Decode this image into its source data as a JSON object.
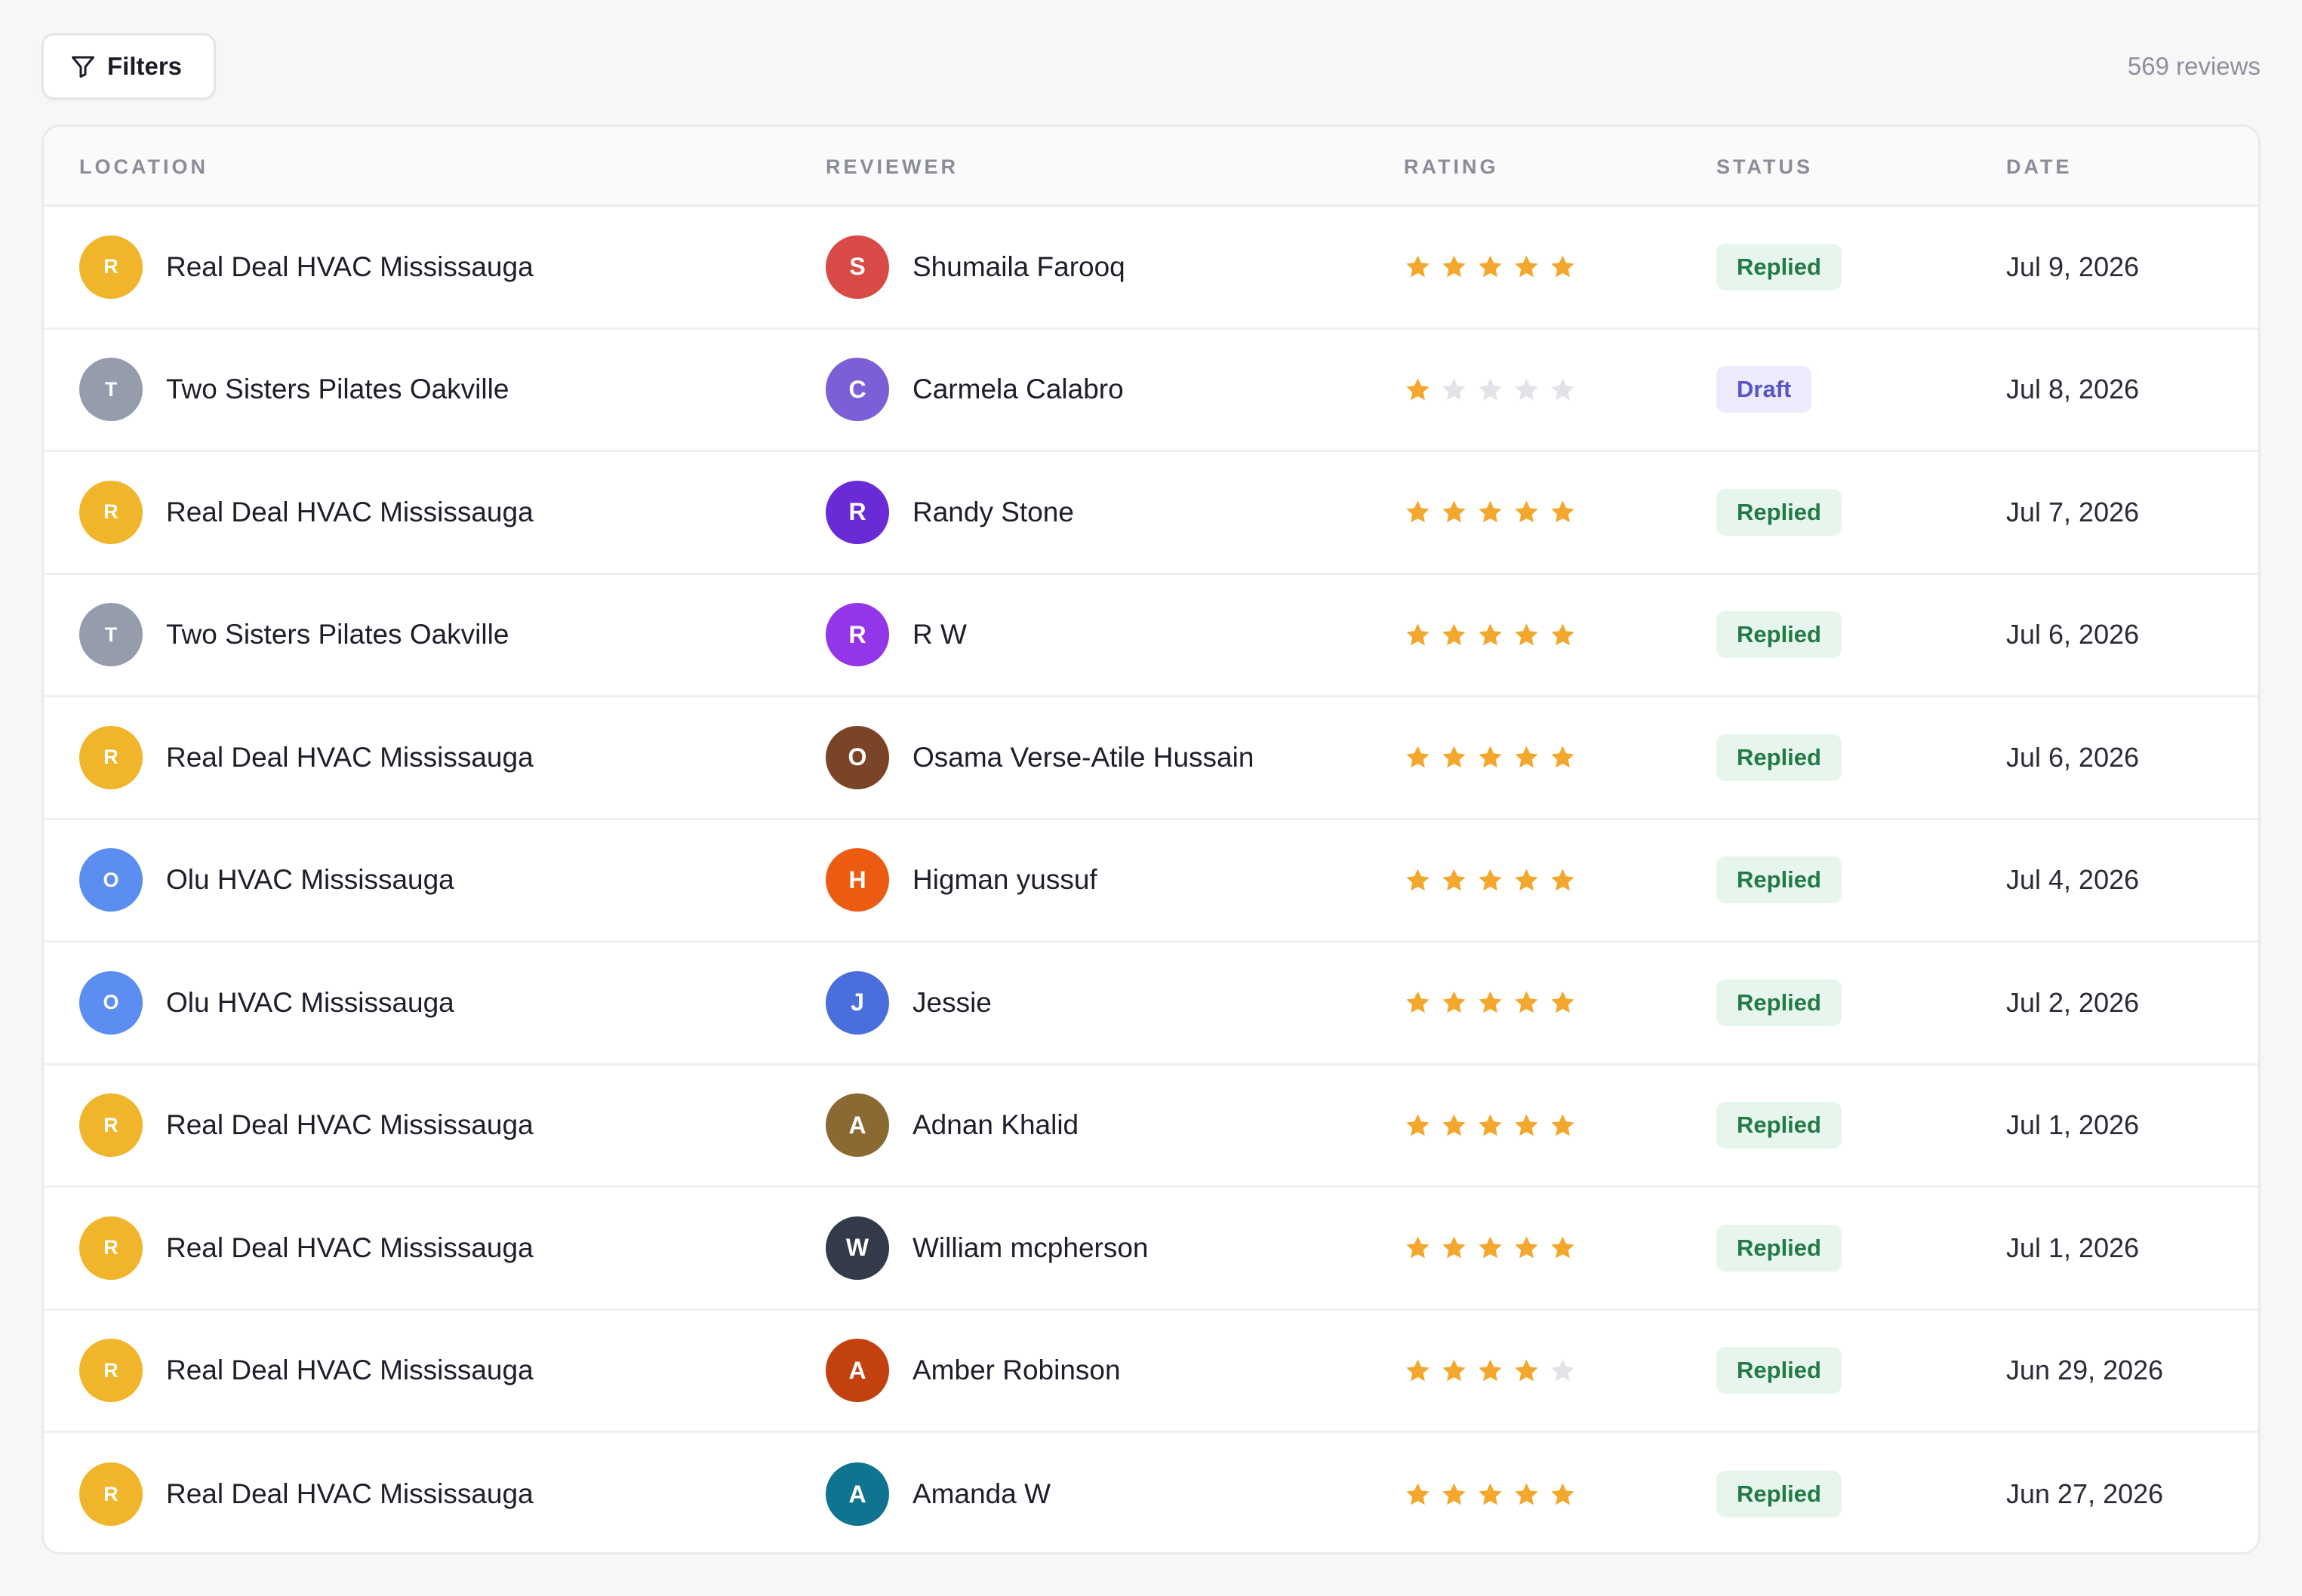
{
  "toolbar": {
    "filters_label": "Filters",
    "review_count": "569 reviews"
  },
  "table": {
    "columns": [
      "LOCATION",
      "REVIEWER",
      "RATING",
      "STATUS",
      "DATE"
    ],
    "rows": [
      {
        "location": "Real Deal HVAC Mississauga",
        "location_initial": "R",
        "location_color": "#f0b52a",
        "reviewer": "Shumaila Farooq",
        "reviewer_initial": "S",
        "reviewer_color": "#d94a47",
        "rating": 5,
        "status": "Replied",
        "date": "Jul 9, 2026"
      },
      {
        "location": "Two Sisters Pilates Oakville",
        "location_initial": "T",
        "location_color": "#959cab",
        "reviewer": "Carmela Calabro",
        "reviewer_initial": "C",
        "reviewer_color": "#7c5fd6",
        "rating": 1,
        "status": "Draft",
        "date": "Jul 8, 2026"
      },
      {
        "location": "Real Deal HVAC Mississauga",
        "location_initial": "R",
        "location_color": "#f0b52a",
        "reviewer": "Randy Stone",
        "reviewer_initial": "R",
        "reviewer_color": "#6a2ad6",
        "rating": 5,
        "status": "Replied",
        "date": "Jul 7, 2026"
      },
      {
        "location": "Two Sisters Pilates Oakville",
        "location_initial": "T",
        "location_color": "#959cab",
        "reviewer": "R W",
        "reviewer_initial": "R",
        "reviewer_color": "#9335e8",
        "rating": 5,
        "status": "Replied",
        "date": "Jul 6, 2026"
      },
      {
        "location": "Real Deal HVAC Mississauga",
        "location_initial": "R",
        "location_color": "#f0b52a",
        "reviewer": "Osama Verse-Atile Hussain",
        "reviewer_initial": "O",
        "reviewer_color": "#7a4426",
        "rating": 5,
        "status": "Replied",
        "date": "Jul 6, 2026"
      },
      {
        "location": "Olu HVAC Mississauga",
        "location_initial": "O",
        "location_color": "#5b8ef0",
        "reviewer": "Higman yussuf",
        "reviewer_initial": "H",
        "reviewer_color": "#ec5b12",
        "rating": 5,
        "status": "Replied",
        "date": "Jul 4, 2026"
      },
      {
        "location": "Olu HVAC Mississauga",
        "location_initial": "O",
        "location_color": "#5b8ef0",
        "reviewer": "Jessie",
        "reviewer_initial": "J",
        "reviewer_color": "#4a6fdc",
        "rating": 5,
        "status": "Replied",
        "date": "Jul 2, 2026"
      },
      {
        "location": "Real Deal HVAC Mississauga",
        "location_initial": "R",
        "location_color": "#f0b52a",
        "reviewer": "Adnan Khalid",
        "reviewer_initial": "A",
        "reviewer_color": "#8a6a32",
        "rating": 5,
        "status": "Replied",
        "date": "Jul 1, 2026"
      },
      {
        "location": "Real Deal HVAC Mississauga",
        "location_initial": "R",
        "location_color": "#f0b52a",
        "reviewer": "William mcpherson",
        "reviewer_initial": "W",
        "reviewer_color": "#333b4a",
        "rating": 5,
        "status": "Replied",
        "date": "Jul 1, 2026"
      },
      {
        "location": "Real Deal HVAC Mississauga",
        "location_initial": "R",
        "location_color": "#f0b52a",
        "reviewer": "Amber Robinson",
        "reviewer_initial": "A",
        "reviewer_color": "#c2410f",
        "rating": 4,
        "status": "Replied",
        "date": "Jun 29, 2026"
      },
      {
        "location": "Real Deal HVAC Mississauga",
        "location_initial": "R",
        "location_color": "#f0b52a",
        "reviewer": "Amanda W",
        "reviewer_initial": "A",
        "reviewer_color": "#0f7490",
        "rating": 5,
        "status": "Replied",
        "date": "Jun 27, 2026"
      }
    ]
  },
  "colors": {
    "star_filled": "#f3a72c",
    "star_empty": "#e2e3e8"
  },
  "icons": {
    "filters": "filter-funnel-icon",
    "star": "star-icon"
  }
}
